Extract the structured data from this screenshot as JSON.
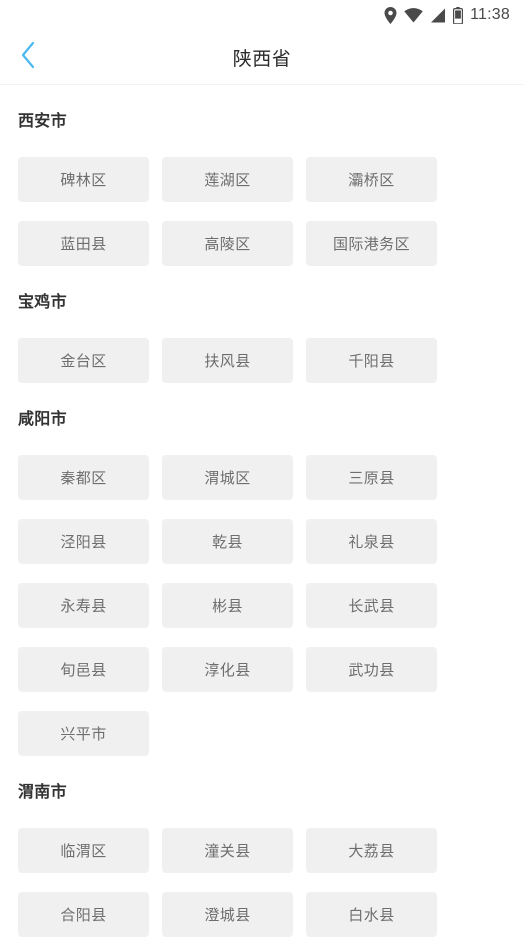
{
  "status_bar": {
    "icons": [
      "location-pin-icon",
      "wifi-icon",
      "signal-icon",
      "battery-icon"
    ],
    "time": "11:38",
    "icon_color": "#4a4a4a"
  },
  "title_bar": {
    "back_icon": "chevron-left-icon",
    "back_icon_color": "#4cb8f0",
    "title": "陕西省"
  },
  "theme": {
    "chip_bg": "#f0f0f1",
    "chip_text": "#6e6e6e",
    "section_title_color": "#333333",
    "page_bg": "#ffffff"
  },
  "sections": [
    {
      "title": "西安市",
      "items": [
        "碑林区",
        "莲湖区",
        "灞桥区",
        "蓝田县",
        "高陵区",
        "国际港务区"
      ]
    },
    {
      "title": "宝鸡市",
      "items": [
        "金台区",
        "扶风县",
        "千阳县"
      ]
    },
    {
      "title": "咸阳市",
      "items": [
        "秦都区",
        "渭城区",
        "三原县",
        "泾阳县",
        "乾县",
        "礼泉县",
        "永寿县",
        "彬县",
        "长武县",
        "旬邑县",
        "淳化县",
        "武功县",
        "兴平市"
      ]
    },
    {
      "title": "渭南市",
      "items": [
        "临渭区",
        "潼关县",
        "大荔县",
        "合阳县",
        "澄城县",
        "白水县"
      ]
    }
  ]
}
